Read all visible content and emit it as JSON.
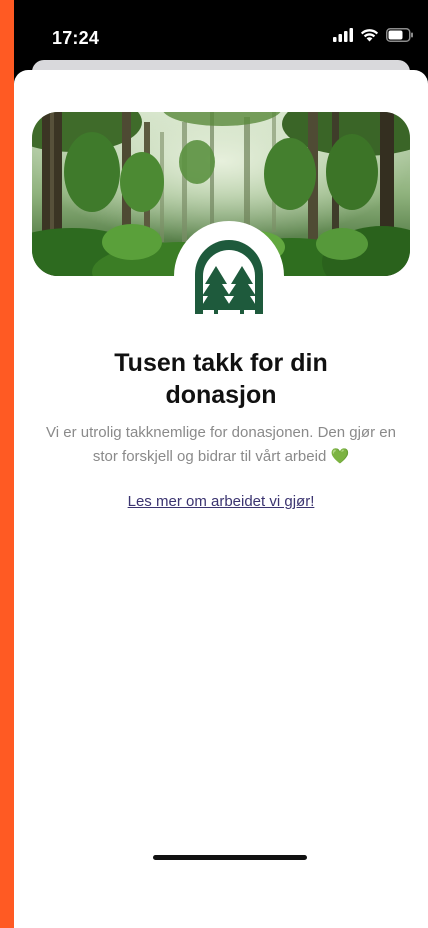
{
  "status_bar": {
    "time": "17:24",
    "icons": [
      "signal-icon",
      "wifi-icon",
      "battery-icon"
    ]
  },
  "hero": {
    "image": "rainforest-illustration",
    "logo_icon": "forest-arch-logo-icon"
  },
  "content": {
    "title": "Tusen takk for din donasjon",
    "subtitle": "Vi er utrolig takknemlige for donasjonen. Den gjør en stor forskjell og bidrar til vårt arbeid 💚",
    "link_label": "Les mer om arbeidet vi gjør!"
  },
  "colors": {
    "accent": "#ff5a23",
    "logo_green": "#1e5a3c",
    "link": "#3b3470"
  }
}
